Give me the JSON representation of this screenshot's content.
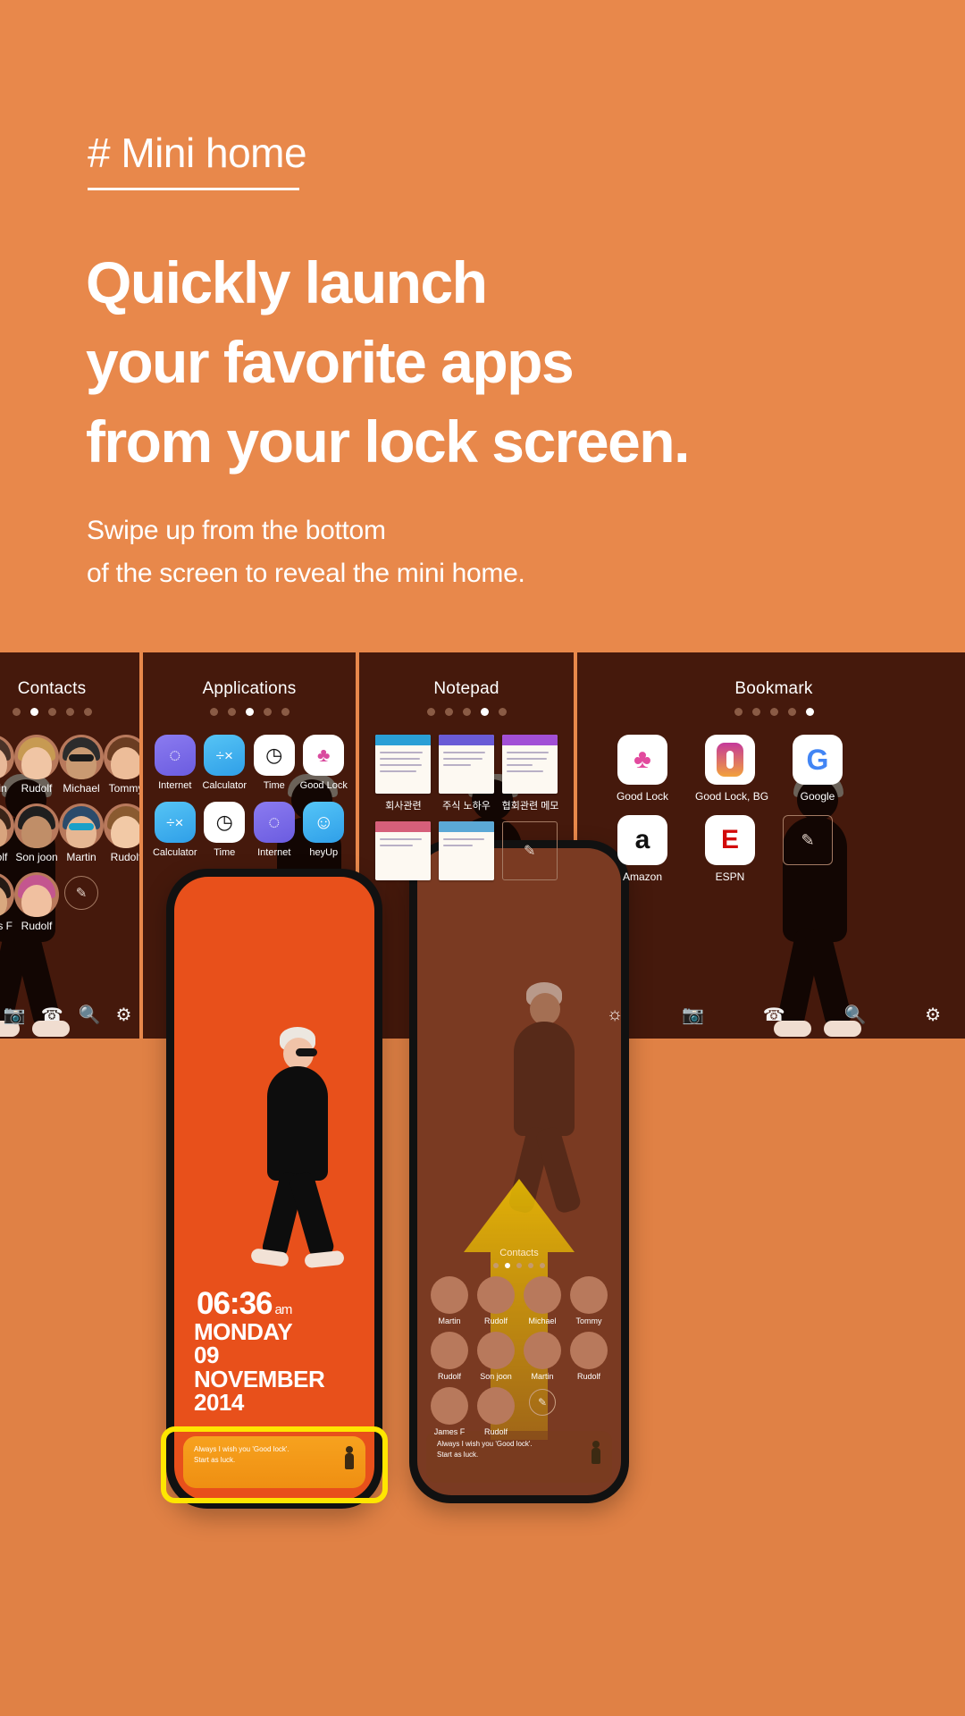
{
  "theme": {
    "bg_orange": "#e8884b",
    "bg_orange_dark": "#e08145",
    "panel_brown": "#45190c",
    "lock_orange": "#e8501b",
    "highlight_yellow": "#ffe600",
    "minibar_amber": "#f7a21e"
  },
  "hero": {
    "tag": "# Mini home",
    "headline_lines": [
      "Quickly launch",
      "your favorite apps",
      "from your lock screen."
    ],
    "subhead_lines": [
      "Swipe up from the bottom",
      "of the screen to reveal the mini home."
    ]
  },
  "carousel": {
    "panels": [
      {
        "title": "Contacts",
        "dots_total": 5,
        "dots_active": 1,
        "contacts": [
          {
            "name": "Martin"
          },
          {
            "name": "Rudolf"
          },
          {
            "name": "Michael"
          },
          {
            "name": "Tommy"
          },
          {
            "name": "Rudolf"
          },
          {
            "name": "Son joon"
          },
          {
            "name": "Martin"
          },
          {
            "name": "Rudolf"
          },
          {
            "name": "James F"
          },
          {
            "name": "Rudolf"
          }
        ],
        "edit_icon": "pencil-icon"
      },
      {
        "title": "Applications",
        "dots_total": 5,
        "dots_active": 2,
        "apps": [
          {
            "label": "Internet",
            "icon": "internet-icon"
          },
          {
            "label": "Calculator",
            "icon": "calculator-icon"
          },
          {
            "label": "Time",
            "icon": "clock-icon"
          },
          {
            "label": "Good Lock",
            "icon": "good-lock-icon"
          },
          {
            "label": "Calculator",
            "icon": "calculator-icon"
          },
          {
            "label": "Time",
            "icon": "clock-icon"
          },
          {
            "label": "Internet",
            "icon": "internet-icon"
          },
          {
            "label": "heyUp",
            "icon": "heyup-icon"
          }
        ]
      },
      {
        "title": "Notepad",
        "dots_total": 5,
        "dots_active": 3,
        "notes": [
          {
            "label": "회사관련",
            "color": "#2a9fd6"
          },
          {
            "label": "주식 노하우",
            "color": "#6a5bd6"
          },
          {
            "label": "협회관련 메모",
            "color": "#a24fd6"
          },
          {
            "label": "",
            "color": "#d65f7a"
          },
          {
            "label": "",
            "color": "#5ba8d6"
          }
        ],
        "add_icon": "pencil-icon"
      },
      {
        "title": "Bookmark",
        "dots_total": 5,
        "dots_active": 4,
        "bookmarks": [
          {
            "label": "Good Lock",
            "icon": "good-lock-icon"
          },
          {
            "label": "Good Lock, BG",
            "icon": "good-lock-bg-icon"
          },
          {
            "label": "Google",
            "icon": "google-icon",
            "glyph": "G"
          },
          {
            "label": "Amazon",
            "icon": "amazon-icon",
            "glyph": "a"
          },
          {
            "label": "ESPN",
            "icon": "espn-icon",
            "glyph": "E"
          }
        ],
        "add_icon": "pencil-icon"
      }
    ],
    "toolbar_icons": [
      "brightness-icon",
      "camera-icon",
      "phone-icon",
      "search-icon",
      "settings-icon"
    ]
  },
  "phones": {
    "left": {
      "clock": {
        "time": "06:36",
        "meridiem": "am",
        "weekday": "MONDAY",
        "day": "09",
        "month": "NOVEMBER",
        "year": "2014"
      },
      "minibar": {
        "line1": "Always I wish you 'Good lock'.",
        "line2": "Start as luck.",
        "handle_icon": "person-icon"
      },
      "highlighted": true
    },
    "right": {
      "overlay_icon": "up-arrow-icon",
      "mini_home": {
        "title": "Contacts",
        "dots_total": 5,
        "dots_active": 1,
        "contacts": [
          {
            "name": "Martin"
          },
          {
            "name": "Rudolf"
          },
          {
            "name": "Michael"
          },
          {
            "name": "Tommy"
          },
          {
            "name": "Rudolf"
          },
          {
            "name": "Son joon"
          },
          {
            "name": "Martin"
          },
          {
            "name": "Rudolf"
          },
          {
            "name": "James F"
          },
          {
            "name": "Rudolf"
          }
        ],
        "edit_icon": "pencil-icon"
      },
      "minibar": {
        "line1": "Always I wish you 'Good lock'.",
        "line2": "Start as luck.",
        "handle_icon": "person-icon"
      }
    }
  }
}
